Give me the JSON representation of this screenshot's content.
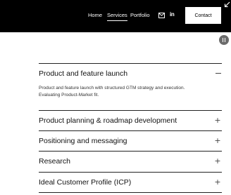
{
  "nav": {
    "links": [
      "Home",
      "Services",
      "Portfolio"
    ],
    "active": "Services",
    "linkedin_label": "in",
    "contact_label": "Contact",
    "icons": [
      "mail-icon",
      "linkedin-icon",
      "collapse-arrow-icon",
      "pause-icon"
    ],
    "bar_color": "#000000"
  },
  "accordion": {
    "items": [
      {
        "title": "Product and feature launch",
        "expanded": true,
        "body": "Product and feature launch with structured GTM strategy and execution.  Evaluating Product-Market fit."
      },
      {
        "title": "Product planning & roadmap development",
        "expanded": false,
        "toggle": "+"
      },
      {
        "title": "Positioning and messaging",
        "expanded": false,
        "toggle": "+"
      },
      {
        "title": "Research",
        "expanded": false,
        "toggle": "+"
      },
      {
        "title": "Ideal Customer Profile (ICP)",
        "expanded": false,
        "toggle": "+"
      }
    ]
  }
}
